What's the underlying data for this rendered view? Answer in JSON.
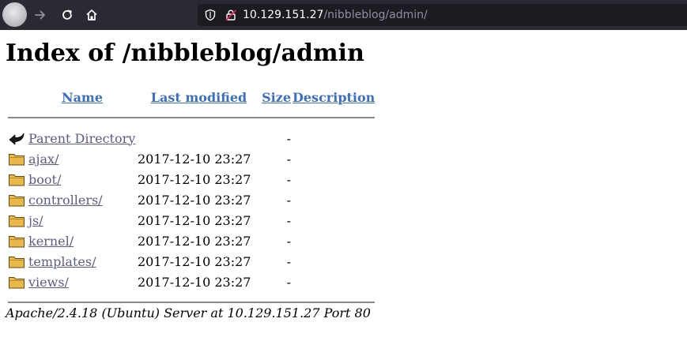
{
  "browser": {
    "url_host": "10.129.151.27",
    "url_path": "/nibbleblog/admin/"
  },
  "page": {
    "title": "Index of /nibbleblog/admin"
  },
  "table": {
    "headers": {
      "name": "Name",
      "last_modified": "Last modified",
      "size": "Size",
      "description": "Description"
    },
    "parent": {
      "name": "Parent Directory",
      "size": "-",
      "icon": "back-arrow-icon"
    },
    "rows": [
      {
        "name": "ajax/",
        "modified": "2017-12-10 23:27",
        "size": "-",
        "icon": "folder-icon"
      },
      {
        "name": "boot/",
        "modified": "2017-12-10 23:27",
        "size": "-",
        "icon": "folder-icon"
      },
      {
        "name": "controllers/",
        "modified": "2017-12-10 23:27",
        "size": "-",
        "icon": "folder-icon"
      },
      {
        "name": "js/",
        "modified": "2017-12-10 23:27",
        "size": "-",
        "icon": "folder-icon"
      },
      {
        "name": "kernel/",
        "modified": "2017-12-10 23:27",
        "size": "-",
        "icon": "folder-icon"
      },
      {
        "name": "templates/",
        "modified": "2017-12-10 23:27",
        "size": "-",
        "icon": "folder-icon"
      },
      {
        "name": "views/",
        "modified": "2017-12-10 23:27",
        "size": "-",
        "icon": "folder-icon"
      }
    ]
  },
  "footer": {
    "text": "Apache/2.4.18 (Ubuntu) Server at 10.129.151.27 Port 80"
  },
  "colors": {
    "toolbar_bg": "#2b2a33",
    "urlbar_bg": "#1c1b22",
    "header_link": "#3a6fc4",
    "file_link": "#5a5c8a",
    "folder": "#e8b84a"
  }
}
